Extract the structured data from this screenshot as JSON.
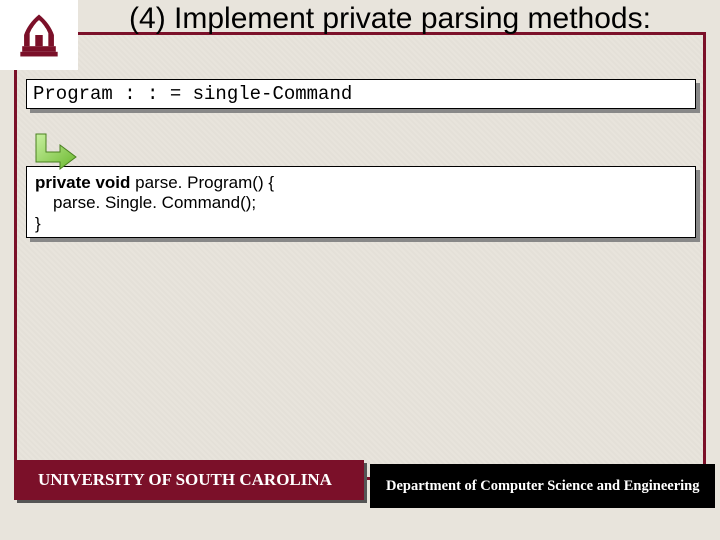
{
  "title": "(4) Implement private parsing methods:",
  "grammar": "Program : : = single-Command",
  "code": {
    "kw1": "private void",
    "line1": " parse. Program() {",
    "line2": "parse. Single. Command();",
    "line3": "}"
  },
  "footer": {
    "left": "UNIVERSITY OF SOUTH CAROLINA",
    "right": "Department of Computer Science and Engineering"
  }
}
